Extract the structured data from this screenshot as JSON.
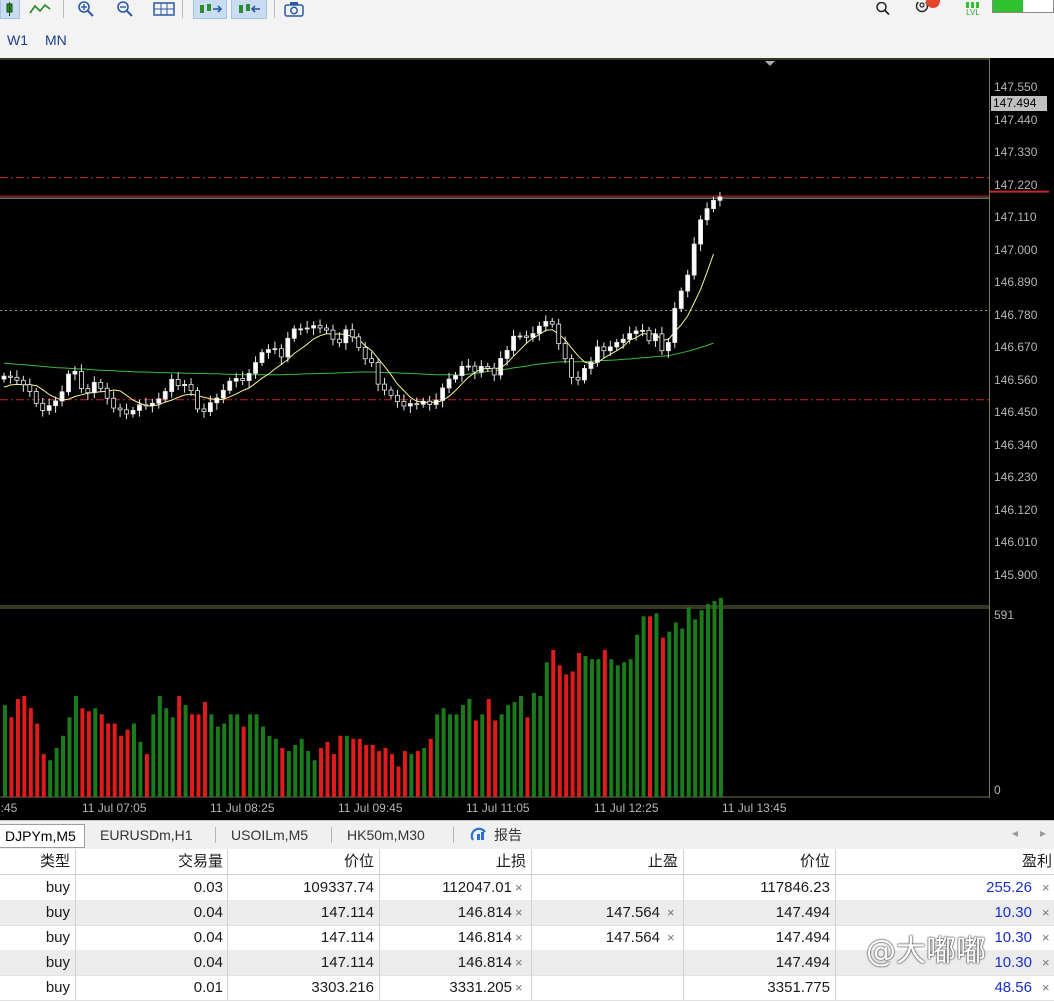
{
  "toolbar": {
    "timeframes": [
      "W1",
      "MN"
    ],
    "icons": [
      "candle-icon",
      "line-chart-icon",
      "zoom-in-icon",
      "zoom-out-icon",
      "grid-icon",
      "autoscroll-icon",
      "chart-shift-icon",
      "screenshot-icon",
      "search-icon",
      "user-icon",
      "lvl-icon"
    ],
    "lvl_label": "LVL"
  },
  "chart": {
    "current_price": "147.494",
    "price_scale": [
      "147.550",
      "147.440",
      "147.330",
      "147.220",
      "147.110",
      "147.000",
      "146.890",
      "146.780",
      "146.670",
      "146.560",
      "146.450",
      "146.340",
      "146.230",
      "146.120",
      "146.010",
      "145.900"
    ],
    "volume_scale": [
      "591",
      "0"
    ],
    "time_labels": [
      "5:45",
      "11 Jul 07:05",
      "11 Jul 08:25",
      "11 Jul 09:45",
      "11 Jul 11:05",
      "11 Jul 12:25",
      "11 Jul 13:45"
    ],
    "colors": {
      "bull": "#ffffff",
      "bear": "#000000",
      "ma_fast": "#f5f58e",
      "ma_slow": "#3dbb3d",
      "vol_up": "#1b7a1b",
      "vol_down": "#e01b1b",
      "level": "#c8282a"
    }
  },
  "chart_data": {
    "type": "candlestick",
    "close": [
      146.888,
      146.884,
      146.874,
      146.859,
      146.836,
      146.796,
      146.772,
      146.788,
      146.804,
      146.835,
      146.895,
      146.904,
      146.846,
      146.832,
      146.867,
      146.847,
      146.813,
      146.78,
      146.774,
      146.76,
      146.772,
      146.791,
      146.789,
      146.796,
      146.811,
      146.836,
      146.877,
      146.856,
      146.86,
      146.839,
      146.777,
      146.768,
      146.798,
      146.814,
      146.84,
      146.871,
      146.88,
      146.873,
      146.897,
      146.934,
      146.968,
      146.978,
      146.981,
      146.953,
      147.016,
      147.048,
      147.048,
      147.051,
      147.059,
      147.051,
      147.044,
      147.013,
      147.001,
      147.045,
      147.021,
      146.985,
      146.947,
      146.934,
      146.861,
      146.841,
      146.823,
      146.802,
      146.787,
      146.795,
      146.793,
      146.803,
      146.792,
      146.806,
      146.848,
      146.878,
      146.89,
      146.921,
      146.922,
      146.902,
      146.921,
      146.915,
      146.892,
      146.948,
      146.975,
      147.023,
      147.024,
      147.019,
      147.032,
      147.057,
      147.073,
      147.064,
      146.998,
      146.947,
      146.884,
      146.875,
      146.914,
      146.935,
      146.987,
      146.974,
      146.987,
      147.002,
      147.013,
      147.032,
      147.041,
      147.043,
      147.008,
      147.031,
      146.974,
      147.002,
      147.117,
      147.176,
      147.23,
      147.335,
      147.417,
      147.455,
      147.483,
      147.494
    ],
    "ma_fast": [
      146.851,
      146.858,
      146.86,
      146.859,
      146.859,
      146.856,
      146.842,
      146.826,
      146.815,
      146.807,
      146.81,
      146.819,
      146.825,
      146.83,
      146.833,
      146.835,
      146.837,
      146.841,
      146.838,
      146.823,
      146.807,
      146.797,
      146.788,
      146.787,
      146.791,
      146.8,
      146.807,
      146.816,
      146.824,
      146.827,
      146.822,
      146.816,
      146.812,
      146.808,
      146.81,
      146.818,
      146.828,
      146.839,
      146.848,
      146.864,
      146.881,
      146.895,
      146.912,
      146.928,
      146.944,
      146.965,
      146.98,
      146.996,
      147.014,
      147.025,
      147.032,
      147.03,
      147.031,
      147.028,
      147.023,
      147.012,
      146.991,
      146.974,
      146.948,
      146.921,
      146.893,
      146.861,
      146.839,
      146.816,
      146.803,
      146.799,
      146.799,
      146.8,
      146.805,
      146.82,
      146.839,
      146.862,
      146.884,
      146.9,
      146.912,
      146.914,
      146.913,
      146.916,
      146.932,
      146.955,
      146.977,
      146.999,
      147.017,
      147.029,
      147.043,
      147.045,
      147.031,
      147.011,
      146.983,
      146.957,
      146.936,
      146.929,
      146.934,
      146.949,
      146.962,
      146.974,
      146.988,
      147.01,
      147.018,
      147.032,
      147.03,
      147.032,
      147.009,
      147.012,
      147.038,
      147.062,
      147.092,
      147.136,
      147.182,
      147.24,
      147.301
    ],
    "ma_slow": [
      146.932,
      146.93,
      146.928,
      146.927,
      146.925,
      146.923,
      146.921,
      146.919,
      146.917,
      146.916,
      146.915,
      146.913,
      146.912,
      146.911,
      146.909,
      146.908,
      146.907,
      146.906,
      146.905,
      146.904,
      146.903,
      146.902,
      146.902,
      146.901,
      146.9,
      146.9,
      146.899,
      146.899,
      146.898,
      146.898,
      146.897,
      146.897,
      146.896,
      146.896,
      146.895,
      146.894,
      146.894,
      146.893,
      146.893,
      146.893,
      146.893,
      146.893,
      146.893,
      146.893,
      146.894,
      146.894,
      146.895,
      146.896,
      146.896,
      146.897,
      146.898,
      146.898,
      146.899,
      146.9,
      146.901,
      146.902,
      146.902,
      146.902,
      146.901,
      146.9,
      146.9,
      146.899,
      146.898,
      146.897,
      146.896,
      146.895,
      146.894,
      146.893,
      146.893,
      146.893,
      146.892,
      146.893,
      146.895,
      146.897,
      146.9,
      146.904,
      146.906,
      146.909,
      146.912,
      146.916,
      146.919,
      146.922,
      146.926,
      146.929,
      146.931,
      146.934,
      146.936,
      146.937,
      146.937,
      146.937,
      146.937,
      146.938,
      146.94,
      146.941,
      146.942,
      146.943,
      146.945,
      146.946,
      146.948,
      146.95,
      146.952,
      146.954,
      146.955,
      146.957,
      146.962,
      146.967,
      146.972,
      146.978,
      146.985,
      146.992,
      147.0
    ],
    "volume": [
      300,
      260,
      320,
      330,
      290,
      240,
      140,
      120,
      160,
      200,
      260,
      330,
      290,
      280,
      290,
      270,
      240,
      240,
      200,
      220,
      240,
      180,
      140,
      270,
      330,
      290,
      260,
      330,
      300,
      270,
      270,
      310,
      270,
      230,
      240,
      270,
      270,
      230,
      270,
      270,
      230,
      200,
      190,
      160,
      150,
      170,
      190,
      150,
      120,
      160,
      180,
      140,
      200,
      200,
      190,
      190,
      170,
      170,
      150,
      160,
      140,
      100,
      150,
      140,
      150,
      160,
      190,
      270,
      290,
      270,
      270,
      300,
      320,
      250,
      270,
      320,
      250,
      270,
      300,
      310,
      330,
      260,
      340,
      330,
      440,
      480,
      430,
      400,
      410,
      470,
      460,
      450,
      450,
      480,
      450,
      430,
      440,
      450,
      530,
      590,
      590,
      600,
      520,
      540,
      570,
      550,
      620,
      580,
      610,
      630,
      640,
      650
    ],
    "levels": [
      147.56,
      147.494,
      147.11,
      146.808
    ],
    "ylim": [
      145.86,
      147.6
    ],
    "vol_max": 591
  },
  "tabs": {
    "items": [
      "DJPYm,M5",
      "EURUSDm,H1",
      "USOILm,M5",
      "HK50m,M30",
      "报告"
    ],
    "active": 0
  },
  "table": {
    "headers": [
      "类型",
      "交易量",
      "价位",
      "止损",
      "止盈",
      "价位",
      "盈利"
    ],
    "rows": [
      {
        "type": "buy",
        "volume": "0.03",
        "price": "109337.74",
        "sl": "112047.01",
        "tp": "",
        "cur": "117846.23",
        "profit": "255.26"
      },
      {
        "type": "buy",
        "volume": "0.04",
        "price": "147.114",
        "sl": "146.814",
        "tp": "147.564",
        "cur": "147.494",
        "profit": "10.30"
      },
      {
        "type": "buy",
        "volume": "0.04",
        "price": "147.114",
        "sl": "146.814",
        "tp": "147.564",
        "cur": "147.494",
        "profit": "10.30"
      },
      {
        "type": "buy",
        "volume": "0.04",
        "price": "147.114",
        "sl": "146.814",
        "tp": "",
        "cur": "147.494",
        "profit": "10.30"
      },
      {
        "type": "buy",
        "volume": "0.01",
        "price": "3303.216",
        "sl": "3331.205",
        "tp": "",
        "cur": "3351.775",
        "profit": "48.56"
      }
    ],
    "close_mark": "×"
  },
  "watermark": "@大嘟嘟"
}
